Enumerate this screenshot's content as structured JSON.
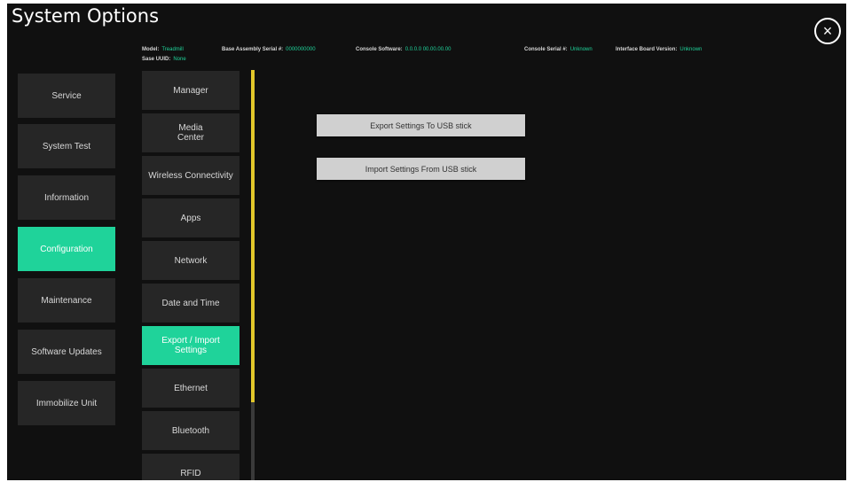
{
  "window": {
    "title": "System Options",
    "close_icon": "×"
  },
  "header_info": {
    "model": {
      "label": "Model:",
      "value": "Treadmill"
    },
    "base_serial": {
      "label": "Base Assembly Serial #:",
      "value": "0000000000"
    },
    "console_software": {
      "label": "Console Software:",
      "value": "0.0.0.0 00.00.00.00"
    },
    "console_serial": {
      "label": "Console Serial #:",
      "value": "Unknown"
    },
    "interface_board": {
      "label": "Interface Board Version:",
      "value": "Unknown"
    },
    "sase_uuid": {
      "label": "Sase UUID:",
      "value": "None"
    }
  },
  "categories": [
    {
      "label": "Service"
    },
    {
      "label": "System Test"
    },
    {
      "label": "Information"
    },
    {
      "label": "Configuration",
      "active": true
    },
    {
      "label": "Maintenance"
    },
    {
      "label": "Software Updates"
    },
    {
      "label": "Immobilize Unit"
    }
  ],
  "subitems": [
    {
      "label": "Manager"
    },
    {
      "label": "Media\nCenter"
    },
    {
      "label": "Wireless Connectivity"
    },
    {
      "label": "Apps"
    },
    {
      "label": "Network"
    },
    {
      "label": "Date and Time"
    },
    {
      "label": "Export / Import\nSettings",
      "active": true
    },
    {
      "label": "Ethernet"
    },
    {
      "label": "Bluetooth"
    },
    {
      "label": "RFID"
    }
  ],
  "actions": {
    "export_label": "Export Settings To USB stick",
    "import_label": "Import Settings From USB stick"
  },
  "colors": {
    "accent": "#1fd39a",
    "scrollbar": "#e2c72a",
    "background": "#101010",
    "tile": "#262626"
  }
}
